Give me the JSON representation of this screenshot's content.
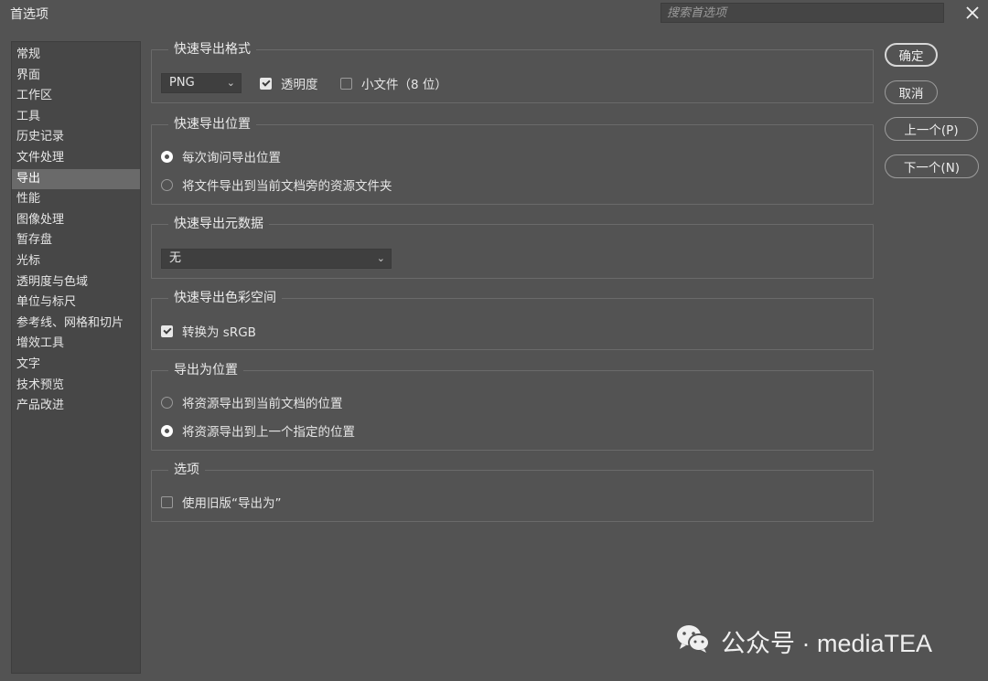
{
  "window": {
    "title": "首选项"
  },
  "search": {
    "placeholder": "搜索首选项"
  },
  "sidebar": {
    "items": [
      {
        "label": "常规"
      },
      {
        "label": "界面"
      },
      {
        "label": "工作区"
      },
      {
        "label": "工具"
      },
      {
        "label": "历史记录"
      },
      {
        "label": "文件处理"
      },
      {
        "label": "导出",
        "active": true
      },
      {
        "label": "性能"
      },
      {
        "label": "图像处理"
      },
      {
        "label": "暂存盘"
      },
      {
        "label": "光标"
      },
      {
        "label": "透明度与色域"
      },
      {
        "label": "单位与标尺"
      },
      {
        "label": "参考线、网格和切片"
      },
      {
        "label": "增效工具"
      },
      {
        "label": "文字"
      },
      {
        "label": "技术预览"
      },
      {
        "label": "产品改进"
      }
    ]
  },
  "sections": {
    "format": {
      "title": "快速导出格式",
      "format_value": "PNG",
      "transparency_label": "透明度",
      "transparency_checked": true,
      "small_file_label": "小文件（8 位）",
      "small_file_checked": false
    },
    "location": {
      "title": "快速导出位置",
      "option1": "每次询问导出位置",
      "option2": "将文件导出到当前文档旁的资源文件夹",
      "selected": 1
    },
    "metadata": {
      "title": "快速导出元数据",
      "value": "无"
    },
    "colorspace": {
      "title": "快速导出色彩空间",
      "convert_label": "转换为 sRGB",
      "convert_checked": true
    },
    "export_as": {
      "title": "导出为位置",
      "option1": "将资源导出到当前文档的位置",
      "option2": "将资源导出到上一个指定的位置",
      "selected": 2
    },
    "options": {
      "title": "选项",
      "legacy_label": "使用旧版“导出为”",
      "legacy_checked": false
    }
  },
  "buttons": {
    "ok": "确定",
    "cancel": "取消",
    "prev": "上一个(P)",
    "next": "下一个(N)"
  },
  "watermark": {
    "text": "公众号 · mediaTEA"
  }
}
